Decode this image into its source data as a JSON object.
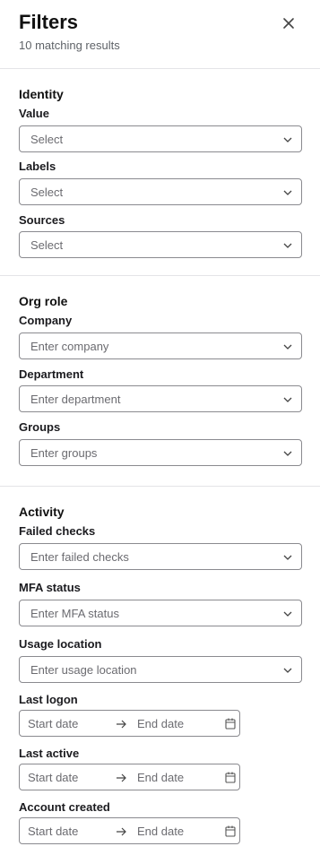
{
  "header": {
    "title": "Filters",
    "subtitle": "10 matching results",
    "close_icon": "close-icon"
  },
  "identity": {
    "title": "Identity",
    "value": {
      "label": "Value",
      "placeholder": "Select"
    },
    "labels": {
      "label": "Labels",
      "placeholder": "Select"
    },
    "sources": {
      "label": "Sources",
      "placeholder": "Select"
    }
  },
  "org_role": {
    "title": "Org role",
    "company": {
      "label": "Company",
      "placeholder": "Enter company"
    },
    "department": {
      "label": "Department",
      "placeholder": "Enter department"
    },
    "groups": {
      "label": "Groups",
      "placeholder": "Enter groups"
    }
  },
  "activity": {
    "title": "Activity",
    "failed_checks": {
      "label": "Failed checks",
      "placeholder": "Enter failed checks"
    },
    "mfa_status": {
      "label": "MFA status",
      "placeholder": "Enter MFA status"
    },
    "usage_location": {
      "label": "Usage location",
      "placeholder": "Enter usage location"
    },
    "last_logon": {
      "label": "Last logon",
      "start": "Start date",
      "end": "End date"
    },
    "last_active": {
      "label": "Last active",
      "start": "Start date",
      "end": "End date"
    },
    "account_created": {
      "label": "Account created",
      "start": "Start date",
      "end": "End date"
    }
  },
  "icons": {
    "dropdown": "chevron-down-icon",
    "date_separator": "arrow-right-icon",
    "date_picker": "calendar-icon"
  }
}
